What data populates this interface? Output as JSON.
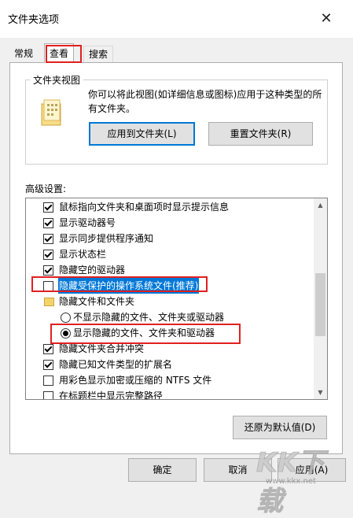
{
  "window": {
    "title": "文件夹选项",
    "close_glyph": "✕"
  },
  "tabs": [
    {
      "label": "常规",
      "selected": false
    },
    {
      "label": "查看",
      "selected": true
    },
    {
      "label": "搜索",
      "selected": false
    }
  ],
  "folder_views": {
    "group_label": "文件夹视图",
    "description": "你可以将此视图(如详细信息或图标)应用于这种类型的所有文件夹。",
    "apply_button": "应用到文件夹(L)",
    "reset_button": "重置文件夹(R)"
  },
  "advanced": {
    "label": "高级设置:",
    "items": [
      {
        "type": "checkbox",
        "checked": true,
        "label": "鼠标指向文件夹和桌面项时显示提示信息"
      },
      {
        "type": "checkbox",
        "checked": true,
        "label": "显示驱动器号"
      },
      {
        "type": "checkbox",
        "checked": true,
        "label": "显示同步提供程序通知"
      },
      {
        "type": "checkbox",
        "checked": true,
        "label": "显示状态栏"
      },
      {
        "type": "checkbox",
        "checked": true,
        "label": "隐藏空的驱动器"
      },
      {
        "type": "checkbox",
        "checked": false,
        "label": "隐藏受保护的操作系统文件(推荐)",
        "selected": true
      },
      {
        "type": "folder",
        "label": "隐藏文件和文件夹"
      },
      {
        "type": "radio",
        "checked": false,
        "label": "不显示隐藏的文件、文件夹或驱动器"
      },
      {
        "type": "radio",
        "checked": true,
        "label": "显示隐藏的文件、文件夹和驱动器"
      },
      {
        "type": "checkbox",
        "checked": true,
        "label": "隐藏文件夹合并冲突"
      },
      {
        "type": "checkbox",
        "checked": true,
        "label": "隐藏已知文件类型的扩展名"
      },
      {
        "type": "checkbox",
        "checked": false,
        "label": "用彩色显示加密或压缩的 NTFS 文件"
      },
      {
        "type": "checkbox",
        "checked": false,
        "label": "在标题栏中显示完整路径"
      }
    ]
  },
  "buttons": {
    "restore_defaults": "还原为默认值(D)",
    "ok": "确定",
    "cancel": "取消",
    "apply": "应用(A)"
  },
  "watermark": {
    "logo_text": "KK下载",
    "url": "www.kkx.net"
  },
  "colors": {
    "highlight": "#e02020",
    "selection": "#0078d7"
  }
}
